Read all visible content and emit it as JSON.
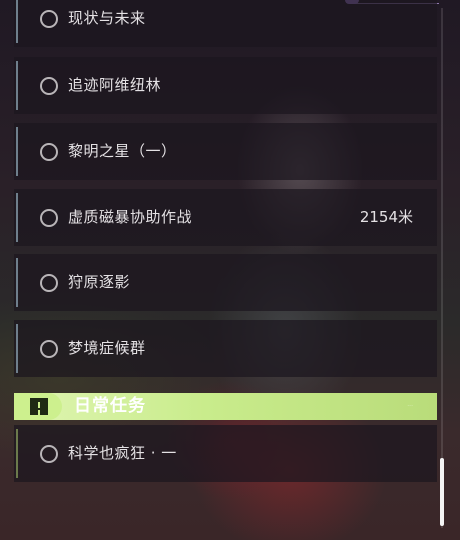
{
  "quests": [
    {
      "title": "现状与未来",
      "distance": ""
    },
    {
      "title": "追迹阿维纽林",
      "distance": ""
    },
    {
      "title": "黎明之星（一）",
      "distance": ""
    },
    {
      "title": "虚质磁暴协助作战",
      "distance": "2154米"
    },
    {
      "title": "狩原逐影",
      "distance": ""
    },
    {
      "title": "梦境症候群",
      "distance": ""
    }
  ],
  "daily_section": {
    "title": "日常任务",
    "icon": "alert-square-icon",
    "quests": [
      {
        "title": "科学也疯狂 · 一"
      }
    ]
  }
}
